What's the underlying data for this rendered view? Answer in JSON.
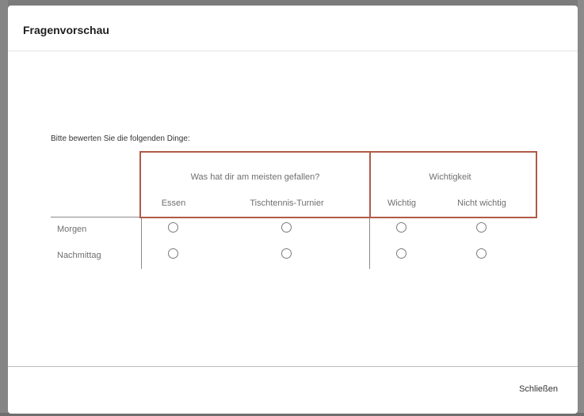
{
  "modal": {
    "title": "Fragenvorschau",
    "close_label": "Schließen"
  },
  "question": {
    "instruction": "Bitte bewerten Sie die folgenden Dinge:",
    "groups": [
      {
        "title": "Was hat dir am meisten gefallen?",
        "columns": [
          "Essen",
          "Tischtennis-Turnier"
        ]
      },
      {
        "title": "Wichtigkeit",
        "columns": [
          "Wichtig",
          "Nicht wichtig"
        ]
      }
    ],
    "rows": [
      "Morgen",
      "Nachmittag"
    ]
  },
  "colors": {
    "highlight": "#b05a48",
    "overlay": "#7b7b7b"
  }
}
